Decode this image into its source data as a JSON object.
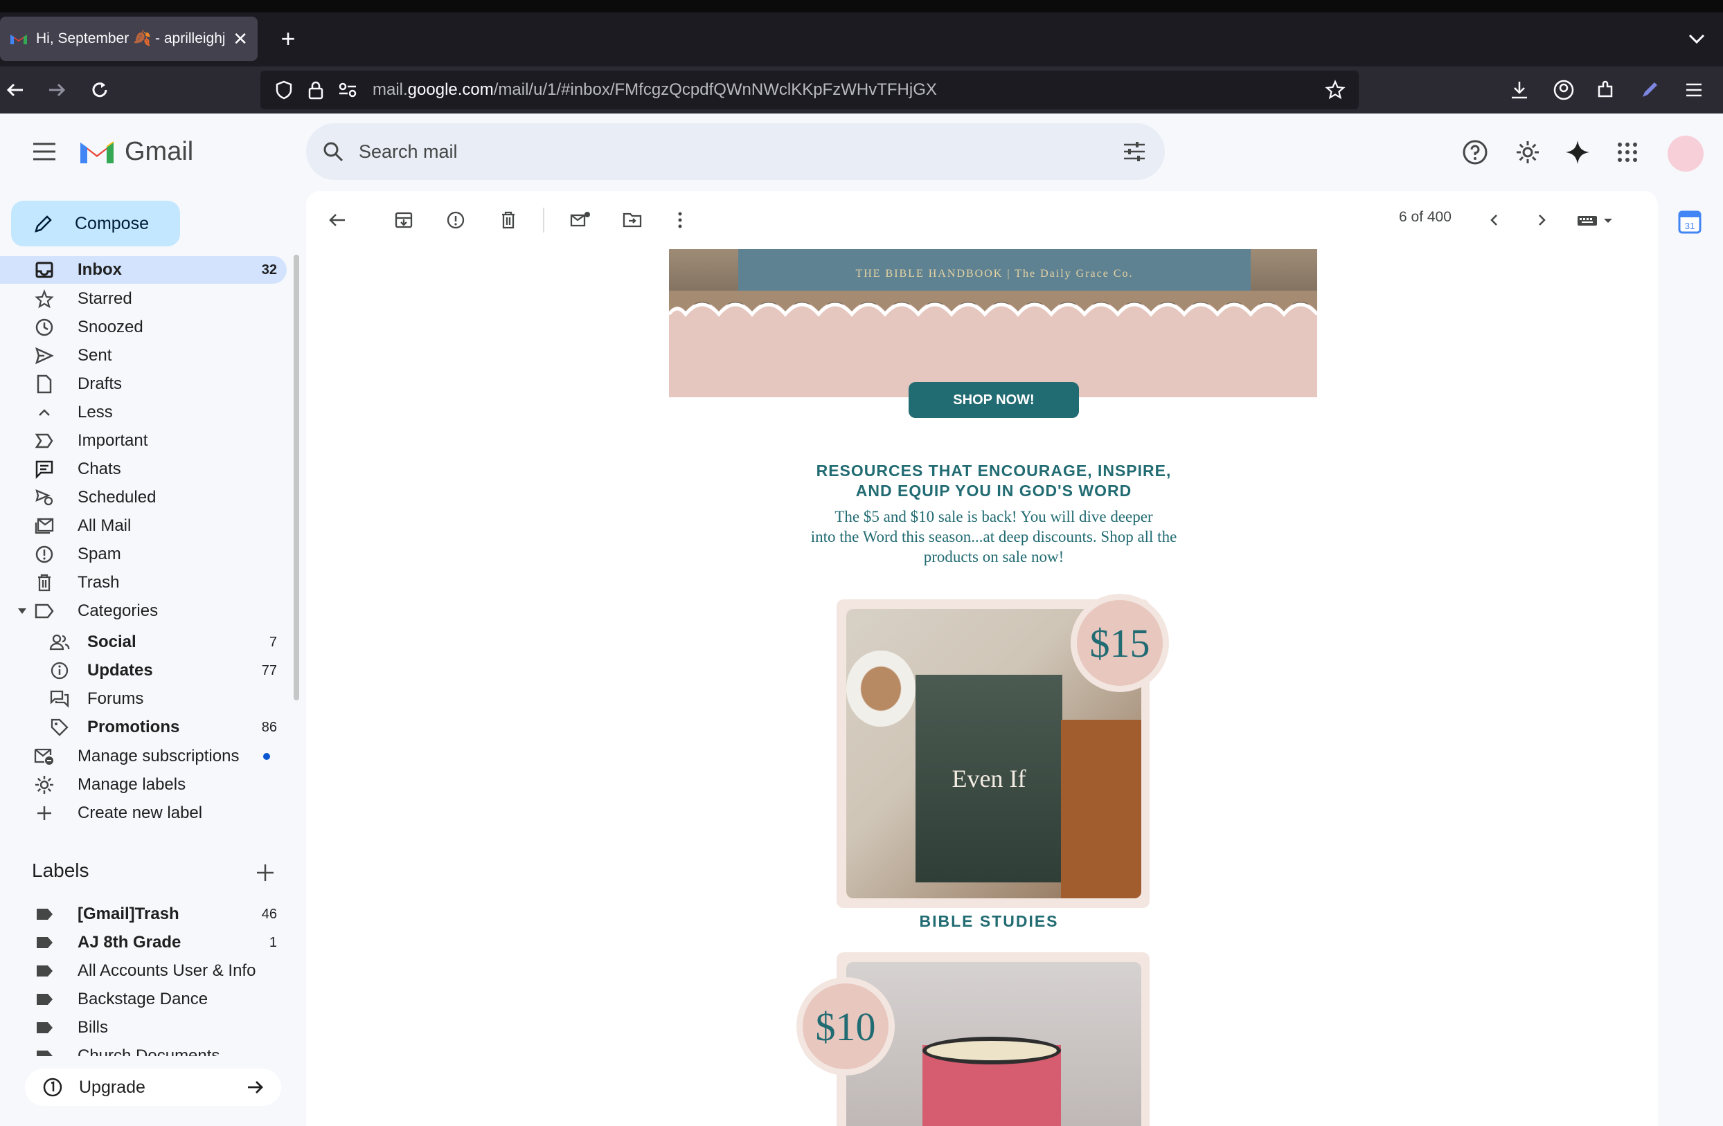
{
  "browser": {
    "tab_title": "Hi, September 🍂 - aprilleighjacl",
    "url_host": "mail.google.com",
    "url_path": "/mail/u/1/#inbox/FMfcgzQcpdfQWnNWclKKpFzWHvTFHjGX",
    "url_prefix": "mail."
  },
  "gmail": {
    "logo_text": "Gmail",
    "search_placeholder": "Search mail",
    "compose_label": "Compose",
    "nav": [
      {
        "label": "Inbox",
        "count": "32",
        "icon": "inbox-icon"
      },
      {
        "label": "Starred",
        "count": "",
        "icon": "star-icon"
      },
      {
        "label": "Snoozed",
        "count": "",
        "icon": "clock-icon"
      },
      {
        "label": "Sent",
        "count": "",
        "icon": "send-icon"
      },
      {
        "label": "Drafts",
        "count": "",
        "icon": "draft-icon"
      },
      {
        "label": "Less",
        "count": "",
        "icon": "chevron-up-icon"
      },
      {
        "label": "Important",
        "count": "",
        "icon": "important-icon"
      },
      {
        "label": "Chats",
        "count": "",
        "icon": "chat-icon"
      },
      {
        "label": "Scheduled",
        "count": "",
        "icon": "scheduled-icon"
      },
      {
        "label": "All Mail",
        "count": "",
        "icon": "all-mail-icon"
      },
      {
        "label": "Spam",
        "count": "",
        "icon": "spam-icon"
      },
      {
        "label": "Trash",
        "count": "",
        "icon": "trash-icon"
      },
      {
        "label": "Categories",
        "count": "",
        "icon": "label-icon"
      }
    ],
    "categories": [
      {
        "label": "Social",
        "count": "7",
        "icon": "people-icon"
      },
      {
        "label": "Updates",
        "count": "77",
        "icon": "info-icon"
      },
      {
        "label": "Forums",
        "count": "",
        "icon": "forum-icon"
      },
      {
        "label": "Promotions",
        "count": "86",
        "icon": "tag-icon"
      }
    ],
    "manage": [
      {
        "label": "Manage subscriptions",
        "icon": "mail-unsubscribe-icon"
      },
      {
        "label": "Manage labels",
        "icon": "gear-icon"
      },
      {
        "label": "Create new label",
        "icon": "plus-icon"
      }
    ],
    "labels_header": "Labels",
    "labels": [
      {
        "label": "[Gmail]Trash",
        "count": "46"
      },
      {
        "label": "AJ 8th Grade",
        "count": "1"
      },
      {
        "label": "All Accounts User & Info",
        "count": ""
      },
      {
        "label": "Backstage Dance",
        "count": ""
      },
      {
        "label": "Bills",
        "count": ""
      },
      {
        "label": "Church Documents",
        "count": ""
      }
    ],
    "upgrade_label": "Upgrade",
    "pagination": "6 of 400"
  },
  "email": {
    "book_spine": "THE BIBLE HANDBOOK  |  The Daily Grace Co.",
    "shop_button": "SHOP NOW!",
    "headline_line1": "RESOURCES THAT ENCOURAGE, INSPIRE,",
    "headline_line2": "AND EQUIP YOU IN GOD'S WORD",
    "body_line1": "The $5 and $10 sale is back! You will dive deeper",
    "body_line2": "into the Word this season...at deep discounts. Shop all the",
    "body_line3": "products on sale now!",
    "card1_price": "$15",
    "card1_book_title": "Even If",
    "card1_caption": "BIBLE STUDIES",
    "card2_price": "$10"
  },
  "colors": {
    "accent": "#216b72",
    "compose_bg": "#c2e7ff",
    "active_nav": "#d3e3fd",
    "hero_pink": "#e6c7c0"
  }
}
